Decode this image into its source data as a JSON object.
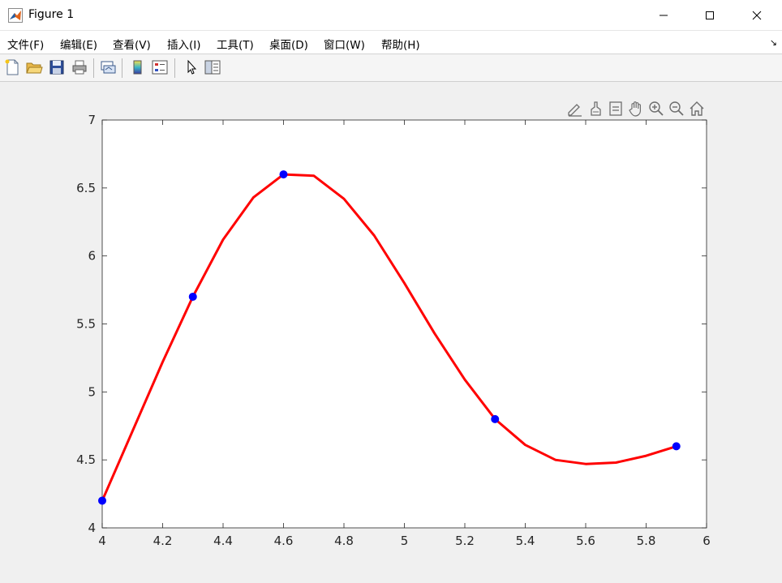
{
  "window": {
    "title": "Figure 1",
    "controls": [
      "minimize",
      "maximize",
      "close"
    ]
  },
  "menu": {
    "items": [
      "文件(F)",
      "编辑(E)",
      "查看(V)",
      "插入(I)",
      "工具(T)",
      "桌面(D)",
      "窗口(W)",
      "帮助(H)"
    ],
    "overflow_glyph": "↘"
  },
  "toolbar": {
    "buttons": [
      "new-figure-icon",
      "open-file-icon",
      "save-icon",
      "print-icon",
      "link-plot-icon",
      "colorbar-icon",
      "legend-icon",
      "pointer-icon",
      "property-inspector-icon"
    ]
  },
  "axes_toolbar": {
    "buttons": [
      "edit-plot-icon",
      "brush-icon",
      "data-tips-icon",
      "pan-icon",
      "zoom-in-icon",
      "zoom-out-icon",
      "home-icon"
    ]
  },
  "chart_data": {
    "type": "line",
    "title": "",
    "xlabel": "",
    "ylabel": "",
    "xlim": [
      4,
      6
    ],
    "ylim": [
      4,
      7
    ],
    "xticks": [
      "4",
      "4.2",
      "4.4",
      "4.6",
      "4.8",
      "5",
      "5.2",
      "5.4",
      "5.6",
      "5.8",
      "6"
    ],
    "yticks": [
      "4",
      "4.5",
      "5",
      "5.5",
      "6",
      "6.5",
      "7"
    ],
    "grid": false,
    "series": [
      {
        "role": "curve",
        "color": "#ff0000",
        "x": [
          4.0,
          4.1,
          4.2,
          4.3,
          4.4,
          4.5,
          4.6,
          4.7,
          4.8,
          4.9,
          5.0,
          5.1,
          5.2,
          5.3,
          5.4,
          5.5,
          5.6,
          5.7,
          5.8,
          5.9
        ],
        "y": [
          4.2,
          4.71,
          5.22,
          5.7,
          6.12,
          6.43,
          6.6,
          6.59,
          6.42,
          6.15,
          5.8,
          5.43,
          5.09,
          4.8,
          4.61,
          4.5,
          4.47,
          4.48,
          4.53,
          4.6
        ]
      },
      {
        "role": "markers",
        "color": "#0000ff",
        "x": [
          4.0,
          4.3,
          4.6,
          5.3,
          5.9
        ],
        "y": [
          4.2,
          5.7,
          6.6,
          4.8,
          4.6
        ]
      }
    ]
  }
}
